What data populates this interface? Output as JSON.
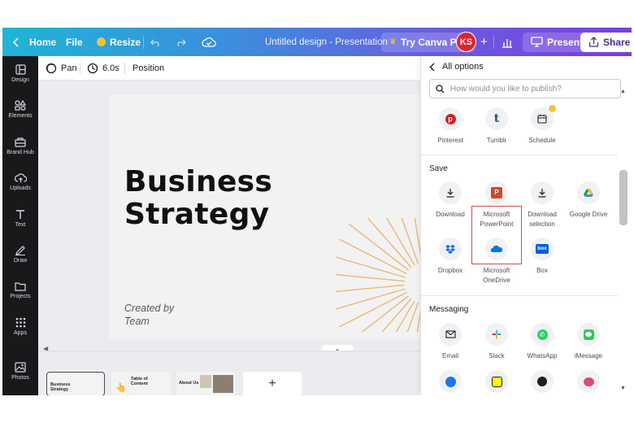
{
  "topbar": {
    "home": "Home",
    "file": "File",
    "resize": "Resize",
    "title": "Untitled design - Presentation",
    "try_pro": "Try Canva Pro",
    "avatar": "KS",
    "present": "Present",
    "share": "Share"
  },
  "sidebar": {
    "items": [
      {
        "label": "Design",
        "icon": "layout-icon"
      },
      {
        "label": "Elements",
        "icon": "shapes-icon"
      },
      {
        "label": "Brand Hub",
        "icon": "brand-icon"
      },
      {
        "label": "Uploads",
        "icon": "upload-cloud-icon"
      },
      {
        "label": "Text",
        "icon": "text-icon"
      },
      {
        "label": "Draw",
        "icon": "pen-icon"
      },
      {
        "label": "Projects",
        "icon": "folder-icon"
      },
      {
        "label": "Apps",
        "icon": "apps-grid-icon"
      },
      {
        "label": "Photos",
        "icon": "photo-icon"
      }
    ]
  },
  "toolbar": {
    "pan": "Pan",
    "duration": "6.0s",
    "position": "Position"
  },
  "slide": {
    "title_line1": "Business",
    "title_line2": "Strategy",
    "subtitle_line1": "Created by",
    "subtitle_line2": "Team"
  },
  "thumbnails": [
    {
      "text_line1": "Business",
      "text_line2": "Strategy"
    },
    {
      "text_line1": "Table of",
      "text_line2": "Content"
    },
    {
      "text_line1": "About Us",
      "text_line2": ""
    },
    {
      "text_line1": "+",
      "text_line2": ""
    }
  ],
  "panel": {
    "back_label": "All options",
    "search_placeholder": "How would you like to publish?",
    "social": [
      {
        "label": "Pinterest",
        "icon": "pinterest-icon"
      },
      {
        "label": "Tumblr",
        "icon": "tumblr-icon"
      },
      {
        "label": "Schedule",
        "icon": "calendar-icon"
      }
    ],
    "save_heading": "Save",
    "save": [
      {
        "label": "Download",
        "icon": "download-icon"
      },
      {
        "label": "Microsoft",
        "label2": "PowerPoint",
        "icon": "powerpoint-icon"
      },
      {
        "label": "Download",
        "label2": "selection",
        "icon": "download-icon"
      },
      {
        "label": "Google Drive",
        "icon": "google-drive-icon"
      },
      {
        "label": "Dropbox",
        "icon": "dropbox-icon"
      },
      {
        "label": "Microsoft",
        "label2": "OneDrive",
        "icon": "onedrive-icon"
      },
      {
        "label": "Box",
        "icon": "box-icon"
      }
    ],
    "messaging_heading": "Messaging",
    "messaging": [
      {
        "label": "Email",
        "icon": "email-icon"
      },
      {
        "label": "Slack",
        "icon": "slack-icon"
      },
      {
        "label": "WhatsApp",
        "icon": "whatsapp-icon"
      },
      {
        "label": "iMessage",
        "icon": "imessage-icon"
      }
    ]
  },
  "colors": {
    "accent_gradient_start": "#1fb5d6",
    "accent_gradient_end": "#7b3fe0",
    "sidebar_bg": "#18191b",
    "highlight_border": "#d24a4a",
    "sunburst": "#e9b77a"
  }
}
